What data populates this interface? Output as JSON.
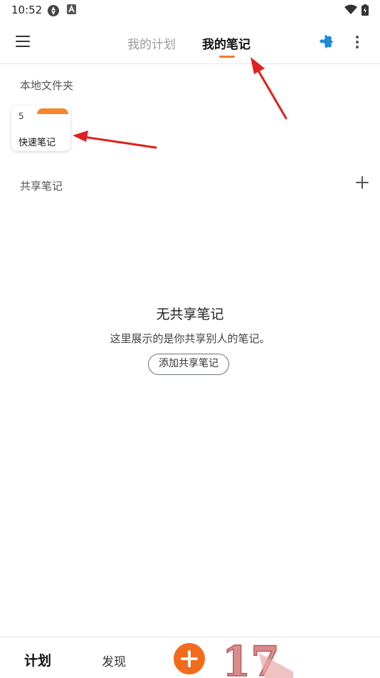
{
  "status_bar": {
    "time": "10:52"
  },
  "header": {
    "tabs": [
      {
        "label": "我的计划",
        "active": false
      },
      {
        "label": "我的笔记",
        "active": true
      }
    ],
    "icons": [
      "menu-icon",
      "puzzle-icon",
      "more-vert-icon"
    ]
  },
  "local_folders": {
    "title": "本地文件夹",
    "items": [
      {
        "count": "5",
        "name": "快速笔记"
      }
    ]
  },
  "shared_notes": {
    "title": "共享笔记",
    "empty": {
      "title": "无共享笔记",
      "description": "这里展示的是你共享别人的笔记。",
      "button_label": "添加共享笔记"
    }
  },
  "bottom_nav": {
    "items": [
      {
        "label": "计划"
      },
      {
        "label": "发现"
      }
    ],
    "watermark_text": "17"
  },
  "colors": {
    "accent": "#f07a2f",
    "fab": "#f26a1b",
    "plugin_icon": "#1f8ad8",
    "annotation_arrow": "#e0201c"
  }
}
